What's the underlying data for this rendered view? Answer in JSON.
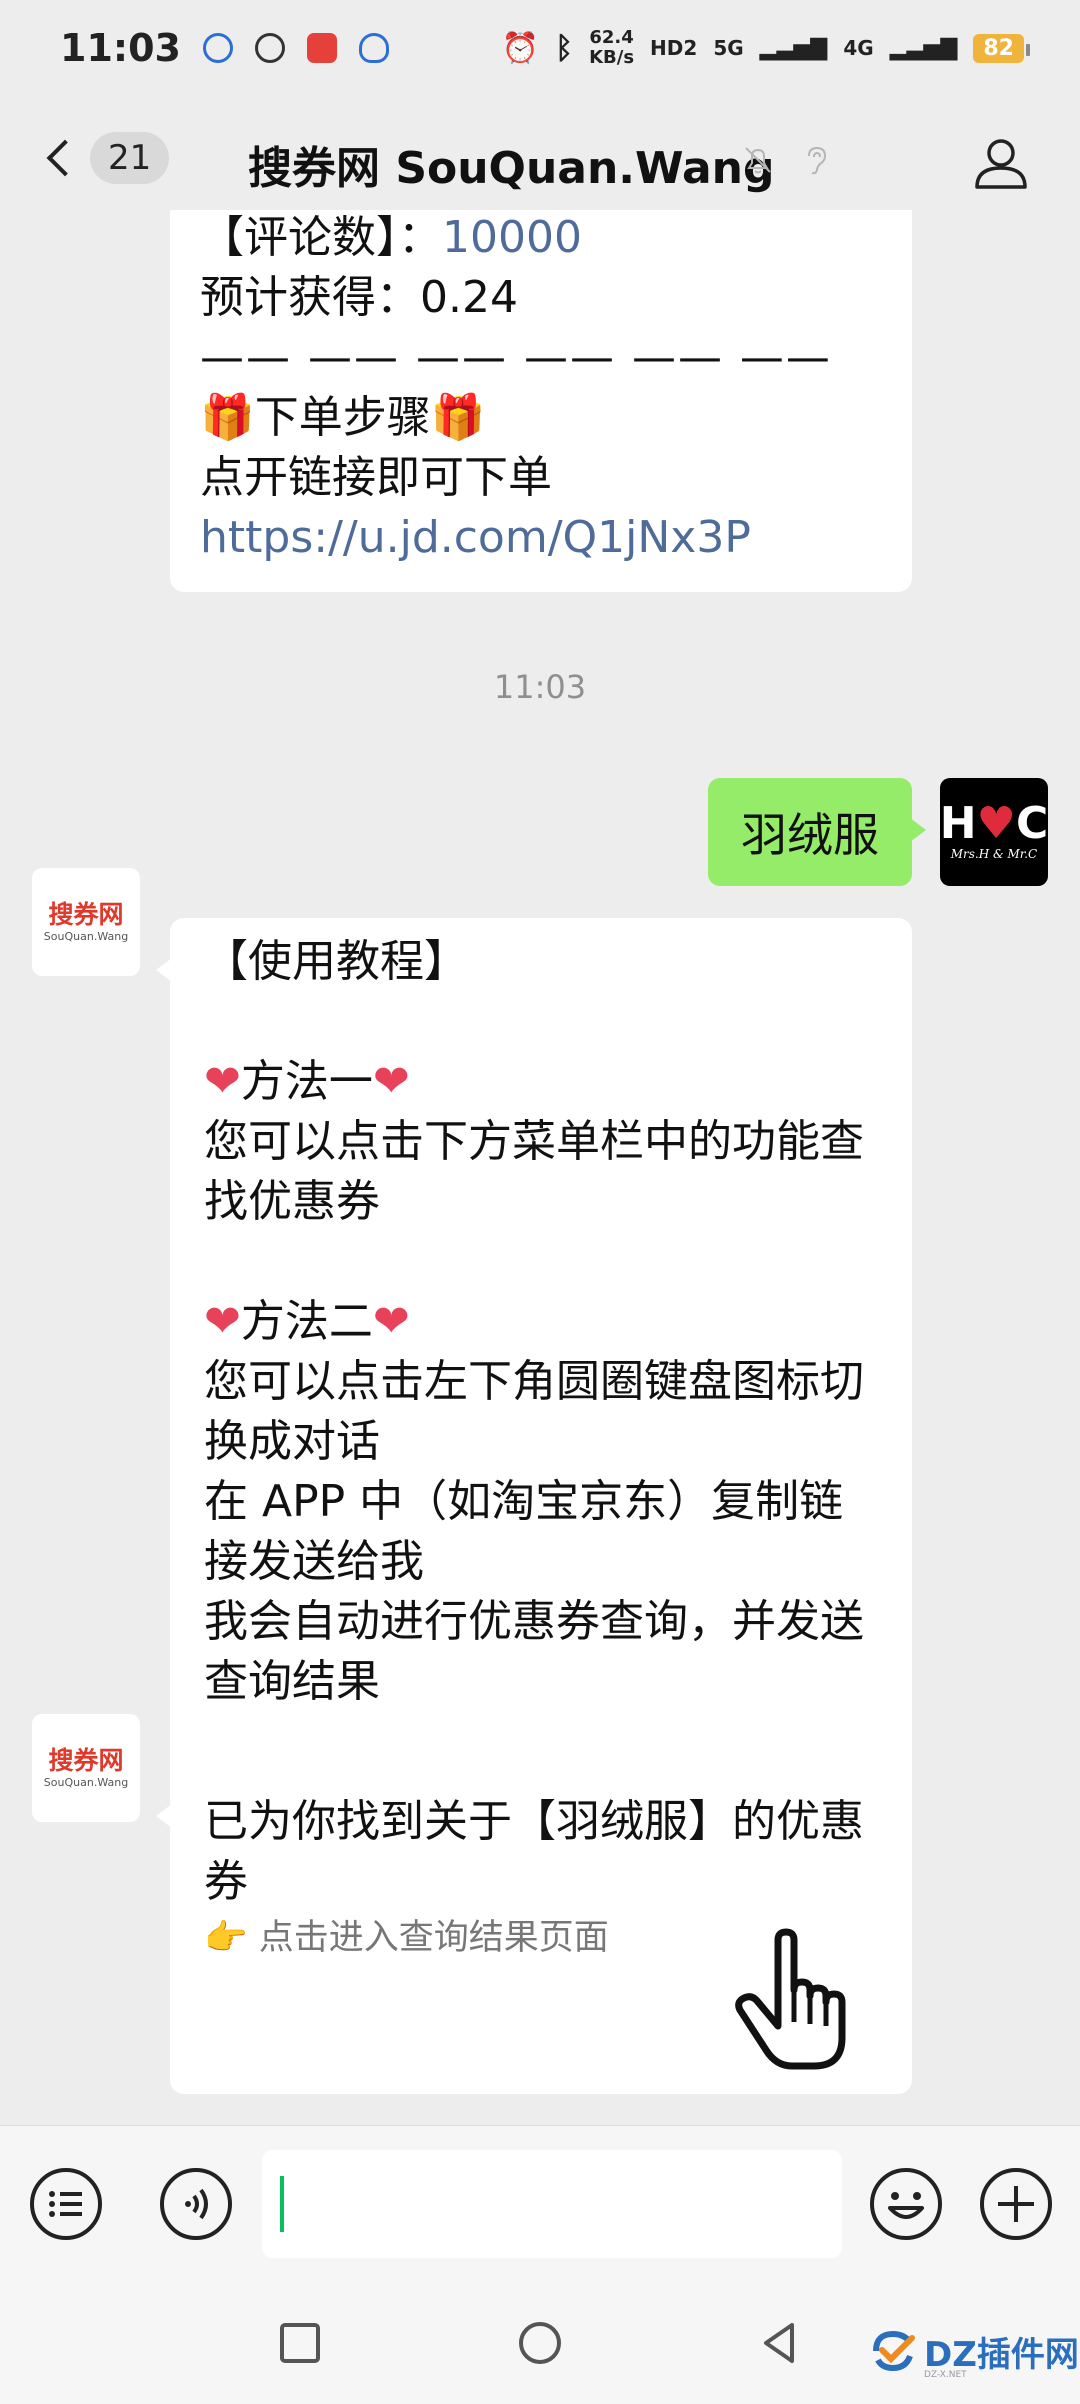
{
  "status_bar": {
    "time": "11:03",
    "net_speed_value": "62.4",
    "net_speed_unit": "KB/s",
    "hd_label": "HD2",
    "signal_5g": "5G",
    "signal_4g": "4G",
    "battery": "82"
  },
  "nav": {
    "unread_count": "21",
    "title": "搜券网 SouQuan.Wang"
  },
  "messages": {
    "prev": {
      "lines": [
        "【评论数】：",
        "预计获得：0.24",
        "—— —— —— —— —— ——",
        "下单步骤",
        "点开链接即可下单"
      ],
      "comment_count": "10000",
      "gift_emoji": "🎁",
      "link": "https://u.jd.com/Q1jNx3P"
    },
    "timestamp": "11:03",
    "sent": {
      "text": "羽绒服",
      "avatar_letters_left": "H",
      "avatar_letters_right": "C",
      "avatar_caption": "Mrs.H & Mr.C"
    },
    "bot_avatar": {
      "logo_cn": "搜券网",
      "logo_en": "SouQuan.Wang"
    },
    "tutorial": {
      "heart_emoji": "❤",
      "lines": [
        "【使用教程】",
        "",
        "方法一",
        "您可以点击下方菜单栏中的功能查",
        "找优惠券",
        "",
        "方法二",
        "您可以点击左下角圆圈键盘图标切",
        "换成对话",
        "在 APP 中（如淘宝京东）复制链",
        "接发送给我",
        "我会自动进行优惠券查询，并发送",
        "查询结果"
      ]
    },
    "result": {
      "lines": [
        "已为你找到关于【羽绒服】的优惠",
        "券"
      ],
      "hint_emoji": "👉",
      "hint": "点击进入查询结果页面"
    }
  },
  "watermark": {
    "text": "DZ插件网",
    "sub": "DZ-X.NET"
  },
  "colors": {
    "sent_bubble": "#95ec69",
    "background": "#ededed",
    "link": "#4f6b9a",
    "accent_green": "#07c160",
    "battery": "#f0b43c"
  }
}
